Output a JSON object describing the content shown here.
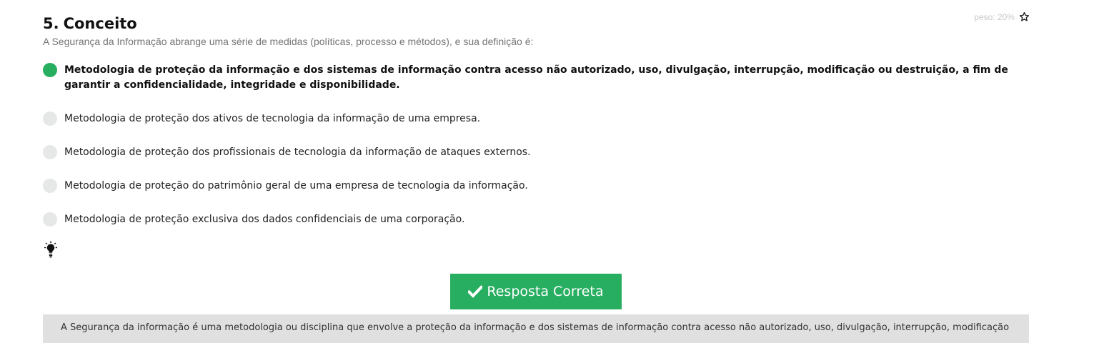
{
  "question": {
    "number": "5.",
    "title": "Conceito",
    "subtitle": "A Segurança da Informação abrange uma série de medidas (políticas, processo e métodos), e sua definição é:",
    "weight": "peso: 20%"
  },
  "options": [
    {
      "text": "Metodologia de proteção da informação e dos sistemas de informação contra acesso não autorizado, uso, divulgação, interrupção, modificação ou destruição, a fim de garantir a confidencialidade, integridade e disponibilidade.",
      "selected": true
    },
    {
      "text": "Metodologia de proteção dos ativos de tecnologia da informação de uma empresa.",
      "selected": false
    },
    {
      "text": "Metodologia de proteção dos profissionais de tecnologia da informação de ataques externos.",
      "selected": false
    },
    {
      "text": "Metodologia de proteção do patrimônio geral de uma empresa de tecnologia da informação.",
      "selected": false
    },
    {
      "text": "Metodologia de proteção exclusiva dos dados confidenciais de uma corporação.",
      "selected": false
    }
  ],
  "icons": {
    "star": "star-outline-icon",
    "hint": "lightbulb-icon",
    "check": "check-icon"
  },
  "result": {
    "label": "Resposta Correta"
  },
  "explanation": {
    "text": "A Segurança da informação é uma metodologia ou disciplina que envolve a proteção da informação e dos sistemas de informação contra acesso não autorizado, uso, divulgação, interrupção, modificação"
  },
  "colors": {
    "accent": "#27ae60",
    "radio_empty": "#e6e8e8",
    "explanation_bg": "#e0e0e0"
  }
}
